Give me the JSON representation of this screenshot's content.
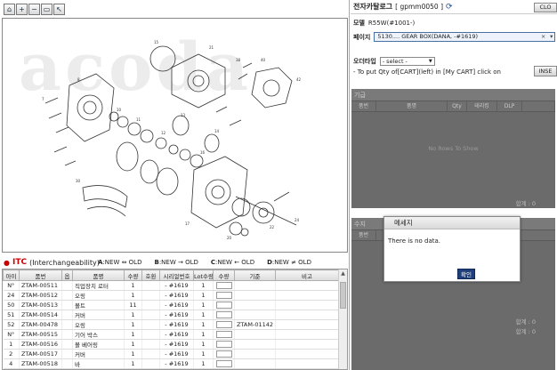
{
  "toolbar": {
    "icons": [
      "home-icon",
      "zoom-in-icon",
      "zoom-out-icon",
      "print-icon",
      "pointer-icon"
    ],
    "glyphs": [
      "⌂",
      "+",
      "−",
      "▭",
      "↖"
    ]
  },
  "watermark": "acoda",
  "itc": {
    "title_prefix": "ITC",
    "title_suffix": "(Interchangeability)",
    "legend": [
      {
        "key": "A",
        "text": ":NEW ⇔ OLD"
      },
      {
        "key": "B",
        "text": ":NEW → OLD"
      },
      {
        "key": "C",
        "text": ":NEW ← OLD"
      },
      {
        "key": "D",
        "text": ":NEW ≠ OLD"
      }
    ],
    "columns": [
      "아이",
      "품번",
      "옵",
      "품명",
      "수량",
      "호환",
      "시리얼번호",
      "Lot수량",
      "수량",
      "기준",
      "비고"
    ],
    "rows": [
      [
        "N°",
        "ZTAM-00511",
        "",
        "직업장치 로터",
        "1",
        "",
        "- #1619",
        "1",
        "",
        "",
        ""
      ],
      [
        "24",
        "ZTAM-00512",
        "",
        "오링",
        "1",
        "",
        "- #1619",
        "1",
        "",
        "",
        ""
      ],
      [
        "50",
        "ZTAM-00513",
        "",
        "볼트",
        "11",
        "",
        "- #1619",
        "1",
        "",
        "",
        ""
      ],
      [
        "51",
        "ZTAM-00514",
        "",
        "커버",
        "1",
        "",
        "- #1619",
        "1",
        "",
        "",
        ""
      ],
      [
        "52",
        "ZTAM-00478",
        "",
        "오링",
        "1",
        "",
        "- #1619",
        "1",
        "",
        "ZTAM-01142",
        ""
      ],
      [
        "N°",
        "ZTAM-00515",
        "",
        "기어 박스",
        "1",
        "",
        "- #1619",
        "1",
        "",
        "",
        ""
      ],
      [
        "1",
        "ZTAM-00516",
        "",
        "볼 베어링",
        "1",
        "",
        "- #1619",
        "1",
        "",
        "",
        ""
      ],
      [
        "2",
        "ZTAM-00517",
        "",
        "커버",
        "1",
        "",
        "- #1619",
        "1",
        "",
        "",
        ""
      ],
      [
        "4",
        "ZTAM-00518",
        "",
        "바",
        "1",
        "",
        "- #1619",
        "1",
        "",
        "",
        ""
      ]
    ]
  },
  "panel": {
    "title": "전자카탈로그",
    "code": "[ gpmm0050 ]",
    "close_label": "CLO",
    "model_label": "모델",
    "model_value": "R55W(#1001-)",
    "page_label": "페이지",
    "page_value": "5130.... GEAR BOX(DANA, -#1619)",
    "option_label": "오더타입",
    "option_value": "- select -",
    "instruction": "- To put Qty of[CART](left) in [My CART] click on",
    "insert_label": "INSE",
    "cart": {
      "header": "기급",
      "columns": [
        "품번",
        "품명",
        "Qty",
        "테리킹",
        "DLP"
      ],
      "empty": "No Rows To Show",
      "total": "합계 : 0"
    },
    "mycart": {
      "header": "수지",
      "columns": [
        "품번"
      ],
      "total1": "합계 : 0",
      "total2": "합계 : 0"
    }
  },
  "dialog": {
    "title": "메세지",
    "message": "There is no data.",
    "ok_label": "확인"
  }
}
